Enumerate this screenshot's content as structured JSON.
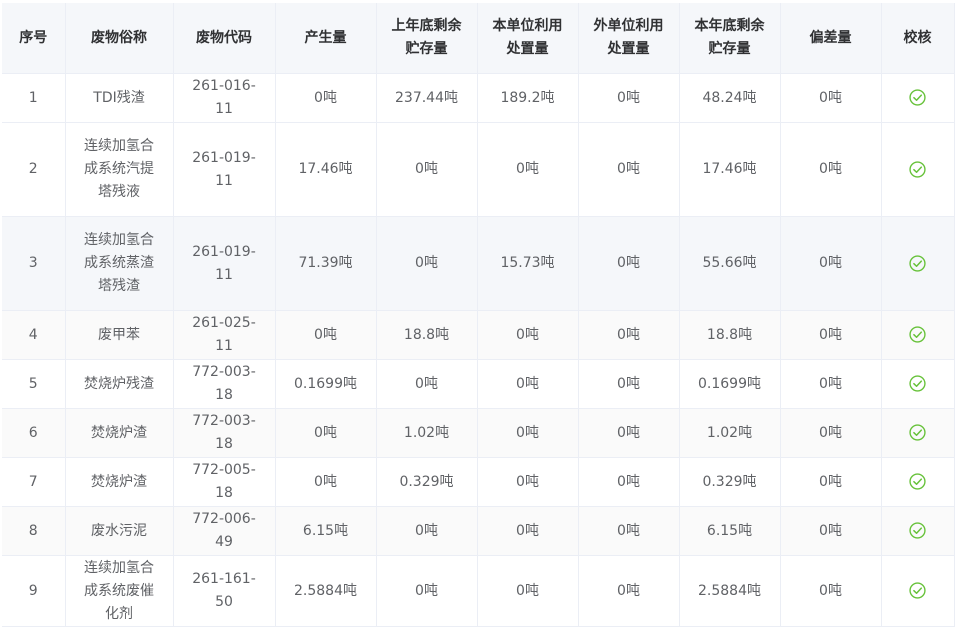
{
  "table": {
    "headers": [
      {
        "id": "index",
        "text": "序号"
      },
      {
        "id": "name",
        "text": "废物俗称"
      },
      {
        "id": "code",
        "text": "废物代码"
      },
      {
        "id": "produced",
        "text": "产生量"
      },
      {
        "id": "last_year_stock",
        "text": "上年底剩余贮存量"
      },
      {
        "id": "self_disposal",
        "text": "本单位利用处置量"
      },
      {
        "id": "external_disposal",
        "text": "外单位利用处置量"
      },
      {
        "id": "this_year_stock",
        "text": "本年底剩余贮存量"
      },
      {
        "id": "deviation",
        "text": "偏差量"
      },
      {
        "id": "verify",
        "text": "校核"
      }
    ],
    "rows": [
      {
        "index": "1",
        "name": "TDI残渣",
        "code": "261-016-11",
        "produced": "0吨",
        "last_year_stock": "237.44吨",
        "self_disposal": "189.2吨",
        "external_disposal": "0吨",
        "this_year_stock": "48.24吨",
        "deviation": "0吨",
        "verify_icon": "check-circle-icon"
      },
      {
        "index": "2",
        "name": "连续加氢合成系统汽提塔残液",
        "code": "261-019-11",
        "produced": "17.46吨",
        "last_year_stock": "0吨",
        "self_disposal": "0吨",
        "external_disposal": "0吨",
        "this_year_stock": "17.46吨",
        "deviation": "0吨",
        "verify_icon": "check-circle-icon"
      },
      {
        "index": "3",
        "name": "连续加氢合成系统蒸渣塔残渣",
        "code": "261-019-11",
        "produced": "71.39吨",
        "last_year_stock": "0吨",
        "self_disposal": "15.73吨",
        "external_disposal": "0吨",
        "this_year_stock": "55.66吨",
        "deviation": "0吨",
        "verify_icon": "check-circle-icon"
      },
      {
        "index": "4",
        "name": "废甲苯",
        "code": "261-025-11",
        "produced": "0吨",
        "last_year_stock": "18.8吨",
        "self_disposal": "0吨",
        "external_disposal": "0吨",
        "this_year_stock": "18.8吨",
        "deviation": "0吨",
        "verify_icon": "check-circle-icon"
      },
      {
        "index": "5",
        "name": "焚烧炉残渣",
        "code": "772-003-18",
        "produced": "0.1699吨",
        "last_year_stock": "0吨",
        "self_disposal": "0吨",
        "external_disposal": "0吨",
        "this_year_stock": "0.1699吨",
        "deviation": "0吨",
        "verify_icon": "check-circle-icon"
      },
      {
        "index": "6",
        "name": "焚烧炉渣",
        "code": "772-003-18",
        "produced": "0吨",
        "last_year_stock": "1.02吨",
        "self_disposal": "0吨",
        "external_disposal": "0吨",
        "this_year_stock": "1.02吨",
        "deviation": "0吨",
        "verify_icon": "check-circle-icon"
      },
      {
        "index": "7",
        "name": "焚烧炉渣",
        "code": "772-005-18",
        "produced": "0吨",
        "last_year_stock": "0.329吨",
        "self_disposal": "0吨",
        "external_disposal": "0吨",
        "this_year_stock": "0.329吨",
        "deviation": "0吨",
        "verify_icon": "check-circle-icon"
      },
      {
        "index": "8",
        "name": "废水污泥",
        "code": "772-006-49",
        "produced": "6.15吨",
        "last_year_stock": "0吨",
        "self_disposal": "0吨",
        "external_disposal": "0吨",
        "this_year_stock": "6.15吨",
        "deviation": "0吨",
        "verify_icon": "check-circle-icon"
      },
      {
        "index": "9",
        "name": "连续加氢合成系统废催化剂",
        "code": "261-161-50",
        "produced": "2.5884吨",
        "last_year_stock": "0吨",
        "self_disposal": "0吨",
        "external_disposal": "0吨",
        "this_year_stock": "2.5884吨",
        "deviation": "0吨",
        "verify_icon": "check-circle-icon"
      }
    ]
  },
  "colors": {
    "header_bg": "#f5f7fa",
    "border": "#ebeef5",
    "text": "#606266",
    "header_text": "#303133",
    "success": "#67c23a"
  }
}
